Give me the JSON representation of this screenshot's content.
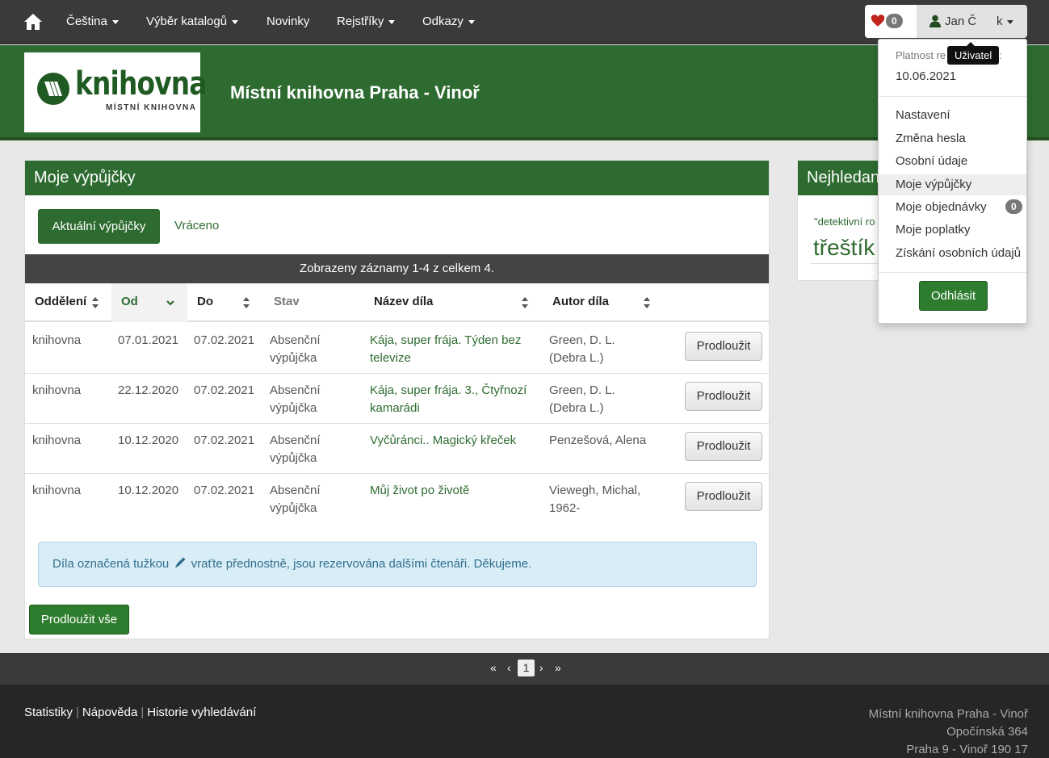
{
  "nav": {
    "items": [
      {
        "label": "Čeština",
        "dropdown": true
      },
      {
        "label": "Výběr katalogů",
        "dropdown": true
      },
      {
        "label": "Novinky",
        "dropdown": false
      },
      {
        "label": "Rejstříky",
        "dropdown": true
      },
      {
        "label": "Odkazy",
        "dropdown": true
      }
    ],
    "favorites_count": "0",
    "user_name": "Jan Č",
    "user_suffix": "k"
  },
  "banner": {
    "logo_word": "knihovna",
    "logo_sub": "MÍSTNÍ KNIHOVNA",
    "title": "Místní knihovna Praha - Vinoř"
  },
  "main": {
    "heading": "Moje výpůjčky",
    "tab_current": "Aktuální výpůjčky",
    "tab_returned": "Vráceno",
    "records": "Zobrazeny záznamy 1-4 z celkem 4.",
    "columns": [
      "Oddělení",
      "Od",
      "Do",
      "Stav",
      "Název díla",
      "Autor díla"
    ],
    "rows": [
      {
        "dept": "knihovna",
        "from": "07.01.2021",
        "to": "07.02.2021",
        "status1": "Absenční",
        "status2": "výpůjčka",
        "title1": "Kája, super frája. Týden bez",
        "title2": "televize",
        "author1": "Green, D. L.",
        "author2": "(Debra L.)"
      },
      {
        "dept": "knihovna",
        "from": "22.12.2020",
        "to": "07.02.2021",
        "status1": "Absenční",
        "status2": "výpůjčka",
        "title1": "Kája, super frája. 3., Čtyřnozí",
        "title2": "kamarádi",
        "author1": "Green, D. L.",
        "author2": "(Debra L.)"
      },
      {
        "dept": "knihovna",
        "from": "10.12.2020",
        "to": "07.02.2021",
        "status1": "Absenční",
        "status2": "výpůjčka",
        "title1": "Vyčůránci.. Magický křeček",
        "title2": "",
        "author1": "Penzešová, Alena",
        "author2": ""
      },
      {
        "dept": "knihovna",
        "from": "10.12.2020",
        "to": "07.02.2021",
        "status1": "Absenční",
        "status2": "výpůjčka",
        "title1": "Můj život po životě",
        "title2": "",
        "author1": "Viewegh, Michal,",
        "author2": "1962-"
      }
    ],
    "extend_label": "Prodloužit",
    "alert_before": "Díla označená tužkou",
    "alert_after": "vraťte přednostně, jsou rezervována dalšími čtenáři. Děkujeme.",
    "extend_all": "Prodloužit vše"
  },
  "side": {
    "heading": "Nejhledan",
    "small_tag": "\"detektivní ro",
    "big_tag": "třeštík"
  },
  "dropdown": {
    "valid_label": "Platnost re",
    "valid_end": ":",
    "valid_date": "10.06.2021",
    "items": [
      "Nastavení",
      "Změna hesla",
      "Osobní údaje",
      "Moje výpůjčky",
      "Moje objednávky",
      "Moje poplatky",
      "Získání osobních údajů"
    ],
    "orders_count": "0",
    "logout": "Odhlásit",
    "tooltip": "Uživatel"
  },
  "pager": {
    "first": "«",
    "prev": "‹",
    "current": "1",
    "next": "›",
    "last": "»"
  },
  "footer": {
    "links": [
      "Statistiky",
      "Nápověda",
      "Historie vyhledávání"
    ],
    "addr1": "Místní knihovna Praha - Vinoř",
    "addr2": "Opočínská 364",
    "addr3": "Praha 9 - Vinoř 190 17"
  },
  "colors": {
    "brand_green": "#2e6b30",
    "nav_dark": "#3a3a3a",
    "footer_dark": "#262626",
    "alert_bg": "#d9edf7"
  }
}
